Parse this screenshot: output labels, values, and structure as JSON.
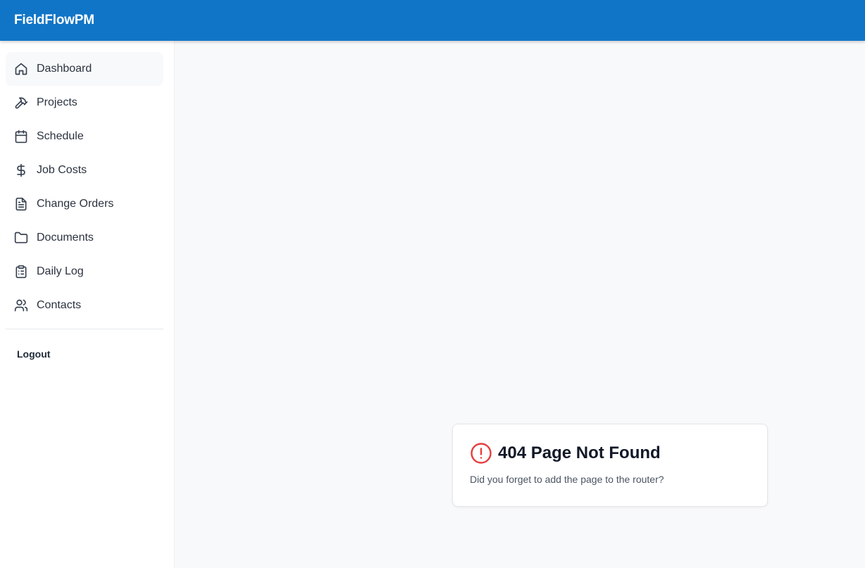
{
  "app": {
    "title": "FieldFlowPM"
  },
  "sidebar": {
    "items": [
      {
        "label": "Dashboard",
        "icon": "home-icon"
      },
      {
        "label": "Projects",
        "icon": "hammer-icon"
      },
      {
        "label": "Schedule",
        "icon": "calendar-icon"
      },
      {
        "label": "Job Costs",
        "icon": "dollar-icon"
      },
      {
        "label": "Change Orders",
        "icon": "file-text-icon"
      },
      {
        "label": "Documents",
        "icon": "folder-icon"
      },
      {
        "label": "Daily Log",
        "icon": "clipboard-icon"
      },
      {
        "label": "Contacts",
        "icon": "users-icon"
      }
    ],
    "logout_label": "Logout"
  },
  "not_found": {
    "title": "404 Page Not Found",
    "message": "Did you forget to add the page to the router?",
    "icon": "alert-circle-icon"
  },
  "colors": {
    "header": "#1175c7",
    "alert": "#e53e3e",
    "background": "#f8f9fb"
  }
}
